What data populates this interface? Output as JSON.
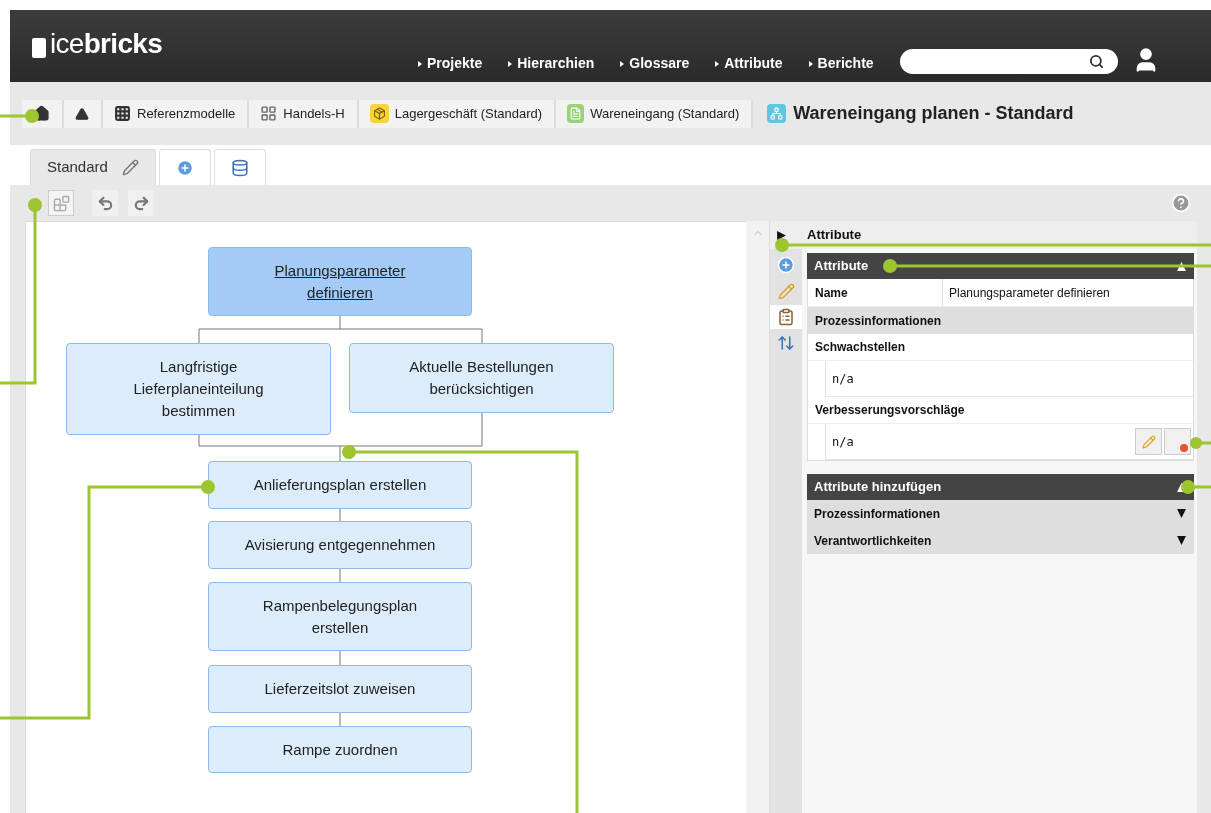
{
  "header": {
    "logo": "ice**bricks**",
    "nav": [
      {
        "label": "Projekte"
      },
      {
        "label": "Hierarchien"
      },
      {
        "label": "Glossare"
      },
      {
        "label": "Attribute"
      },
      {
        "label": "Berichte"
      }
    ]
  },
  "breadcrumb": [
    {
      "kind": "home"
    },
    {
      "kind": "up"
    },
    {
      "kind": "grid",
      "label": "Referenzmodelle"
    },
    {
      "kind": "tiles",
      "label": "Handels-H"
    },
    {
      "kind": "box",
      "label": "Lagergeschäft (Standard)"
    },
    {
      "kind": "list",
      "label": "Wareneingang (Standard)"
    }
  ],
  "title": "Wareneingang planen - Standard",
  "tabs": [
    {
      "kind": "named",
      "label": "Standard",
      "selected": true
    },
    {
      "kind": "add",
      "selected": false
    },
    {
      "kind": "export",
      "selected": false
    }
  ],
  "diagram": {
    "nodes": [
      {
        "label": "Planungsparameter definieren",
        "selected": true
      },
      {
        "label": "Langfristige Lieferplaneinteilung bestimmen",
        "selected": false
      },
      {
        "label": "Aktuelle Bestellungen berücksichtigen",
        "selected": false
      },
      {
        "label": "Anlieferungsplan erstellen",
        "selected": false
      },
      {
        "label": "Avisierung entgegennehmen",
        "selected": false
      },
      {
        "label": "Rampenbelegungsplan erstellen",
        "selected": false
      },
      {
        "label": "Lieferzeitslot zuweisen",
        "selected": false
      },
      {
        "label": "Rampe zuordnen",
        "selected": false
      }
    ]
  },
  "side_tools": [
    {
      "kind": "add",
      "selected": false
    },
    {
      "kind": "edit",
      "selected": false
    },
    {
      "kind": "clipboard",
      "selected": true
    },
    {
      "kind": "move",
      "selected": false
    }
  ],
  "panel": {
    "title": "Attribute",
    "attributes": {
      "title": "Attribute",
      "expanded": true,
      "name_label": "Name",
      "name_value": "Planungsparameter definieren",
      "group": "Prozessinformationen",
      "fields": [
        {
          "label": "Schwachstellen",
          "value": "n/a",
          "actions": false
        },
        {
          "label": "Verbesserungsvorschläge",
          "value": "n/a",
          "actions": true
        }
      ]
    },
    "add": {
      "title": "Attribute hinzufügen",
      "expanded": true,
      "groups": [
        {
          "label": "Prozessinformationen",
          "expanded": false
        },
        {
          "label": "Verantwortlichkeiten",
          "expanded": false
        }
      ]
    }
  }
}
